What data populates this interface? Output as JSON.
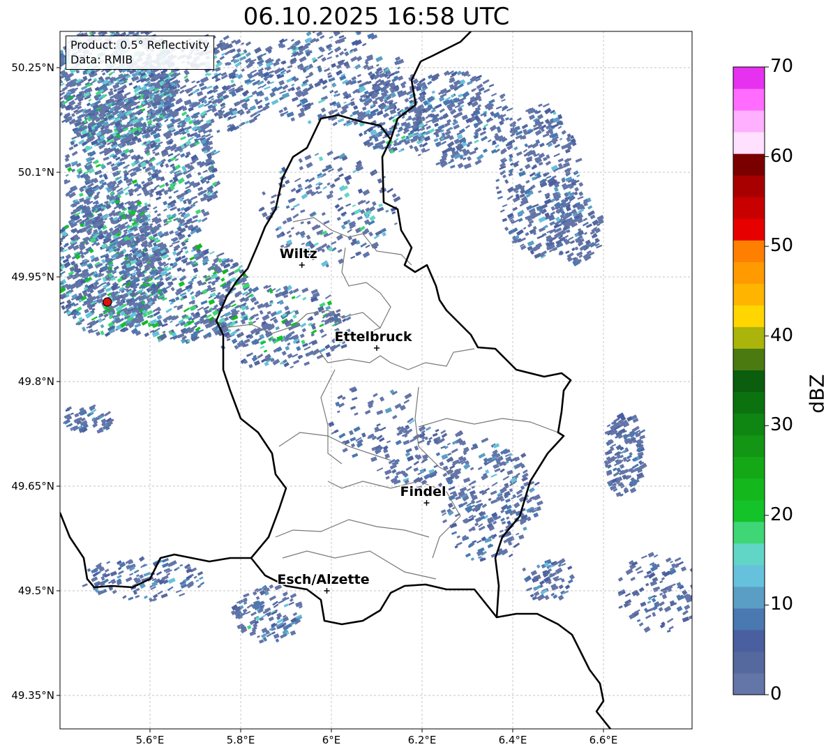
{
  "title": "06.10.2025 16:58 UTC",
  "info_box": {
    "product": "Product: 0.5° Reflectivity",
    "data": "Data: RMIB"
  },
  "axes": {
    "lon_ticks": [
      "5.6°E",
      "5.8°E",
      "6°E",
      "6.2°E",
      "6.4°E",
      "6.6°E"
    ],
    "lat_ticks": [
      "50.25°N",
      "50.1°N",
      "49.95°N",
      "49.8°N",
      "49.65°N",
      "49.5°N",
      "49.35°N"
    ]
  },
  "cities": [
    {
      "name": "Wiltz",
      "lon": 5.935,
      "lat": 49.967
    },
    {
      "name": "Ettelbruck",
      "lon": 6.1,
      "lat": 49.848
    },
    {
      "name": "Findel",
      "lon": 6.21,
      "lat": 49.626
    },
    {
      "name": "Esch/Alzette",
      "lon": 5.99,
      "lat": 49.5
    }
  ],
  "radar_site": {
    "lon": 5.506,
    "lat": 49.914
  },
  "colorbar": {
    "label": "dBZ",
    "ticks": [
      "0",
      "10",
      "20",
      "30",
      "40",
      "50",
      "60",
      "70"
    ],
    "colors": [
      "#6475a8",
      "#56699e",
      "#4a5fa0",
      "#4a78b0",
      "#5a9ec5",
      "#66c2dc",
      "#62d6c6",
      "#3fd676",
      "#14c22a",
      "#14b81c",
      "#14a816",
      "#129614",
      "#0f8612",
      "#0c7210",
      "#0b5e0d",
      "#4a7a10",
      "#aab40a",
      "#ffd600",
      "#ffb400",
      "#ff9a00",
      "#ff7f00",
      "#e60000",
      "#c80000",
      "#a80000",
      "#7a0000",
      "#ffe0ff",
      "#ffb0ff",
      "#ff6cff",
      "#e632f0"
    ]
  }
}
